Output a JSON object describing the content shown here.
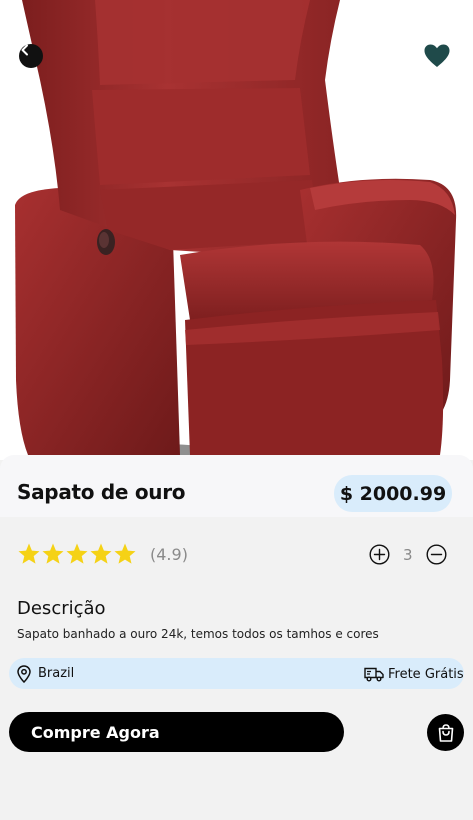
{
  "product": {
    "title": "Sapato de ouro",
    "price": "$ 2000.99",
    "image_subject": "red leather recliner armchair"
  },
  "rating": {
    "stars": 5,
    "value_label": "(4.9)",
    "star_color": "#f5d216"
  },
  "quantity": {
    "value": "3"
  },
  "description": {
    "heading": "Descrição",
    "text": "Sapato banhado a ouro 24k, temos todos os tamhos e cores"
  },
  "info": {
    "location": "Brazil",
    "shipping": "Frete Grátis"
  },
  "actions": {
    "buy_label": "Compre Agora"
  },
  "colors": {
    "accent_light_blue": "#d9ecfb",
    "favorite_green": "#1f4a4a",
    "primary_black": "#000000",
    "chair_red": "#9c2a2a"
  },
  "icons": {
    "back": "chevron-left-icon",
    "favorite": "heart-icon",
    "plus": "plus-circle-icon",
    "minus": "minus-circle-icon",
    "location": "map-pin-icon",
    "shipping": "truck-icon",
    "cart": "shopping-bag-icon"
  }
}
